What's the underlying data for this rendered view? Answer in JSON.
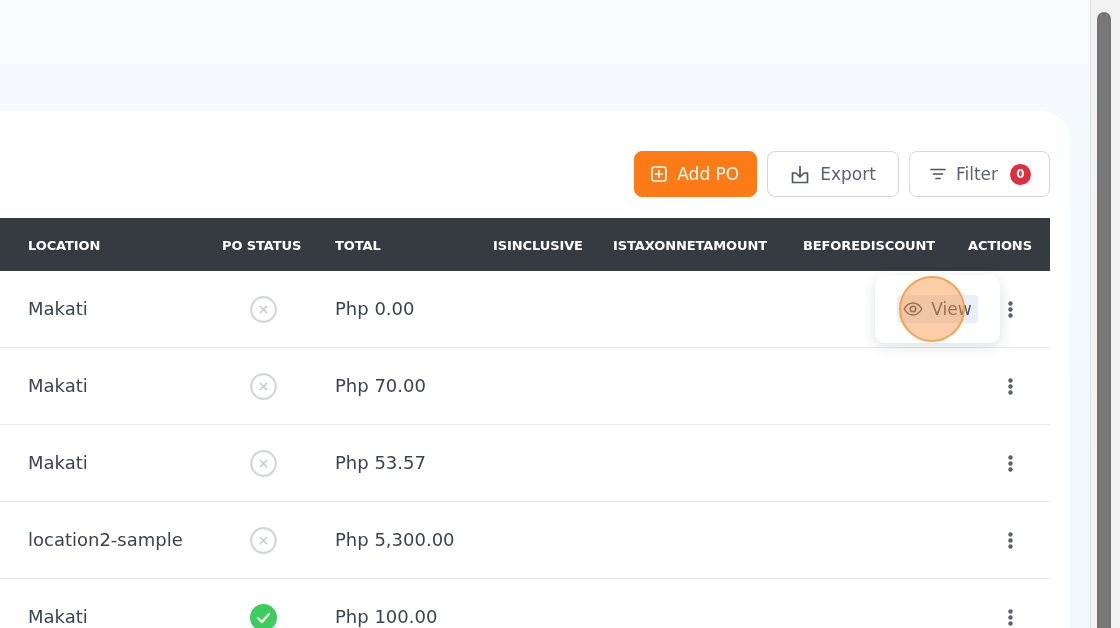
{
  "toolbar": {
    "buttons": [
      {
        "kind": "add",
        "label": "Add PO"
      },
      {
        "kind": "export",
        "label": "Export"
      },
      {
        "kind": "filter",
        "label": "Filter",
        "badge": "0"
      }
    ]
  },
  "table": {
    "columns": [
      "LOCATION",
      "PO STATUS",
      "TOTAL",
      "ISINCLUSIVE",
      "ISTAXONNETAMOUNT",
      "BEFOREDISCOUNT",
      "ACTIONS"
    ],
    "rows": [
      {
        "location": "Makati",
        "approved": false,
        "total": "Php 0.00",
        "menu": {
          "items": [
            {
              "label": "View",
              "selected": true,
              "clicked": true
            }
          ]
        }
      },
      {
        "location": "Makati",
        "approved": false,
        "total": "Php 70.00"
      },
      {
        "location": "Makati",
        "approved": false,
        "total": "Php 53.57"
      },
      {
        "location": "location2-sample",
        "approved": false,
        "total": "Php 5,300.00"
      },
      {
        "location": "Makati",
        "approved": true,
        "total": "Php 100.00"
      }
    ]
  }
}
